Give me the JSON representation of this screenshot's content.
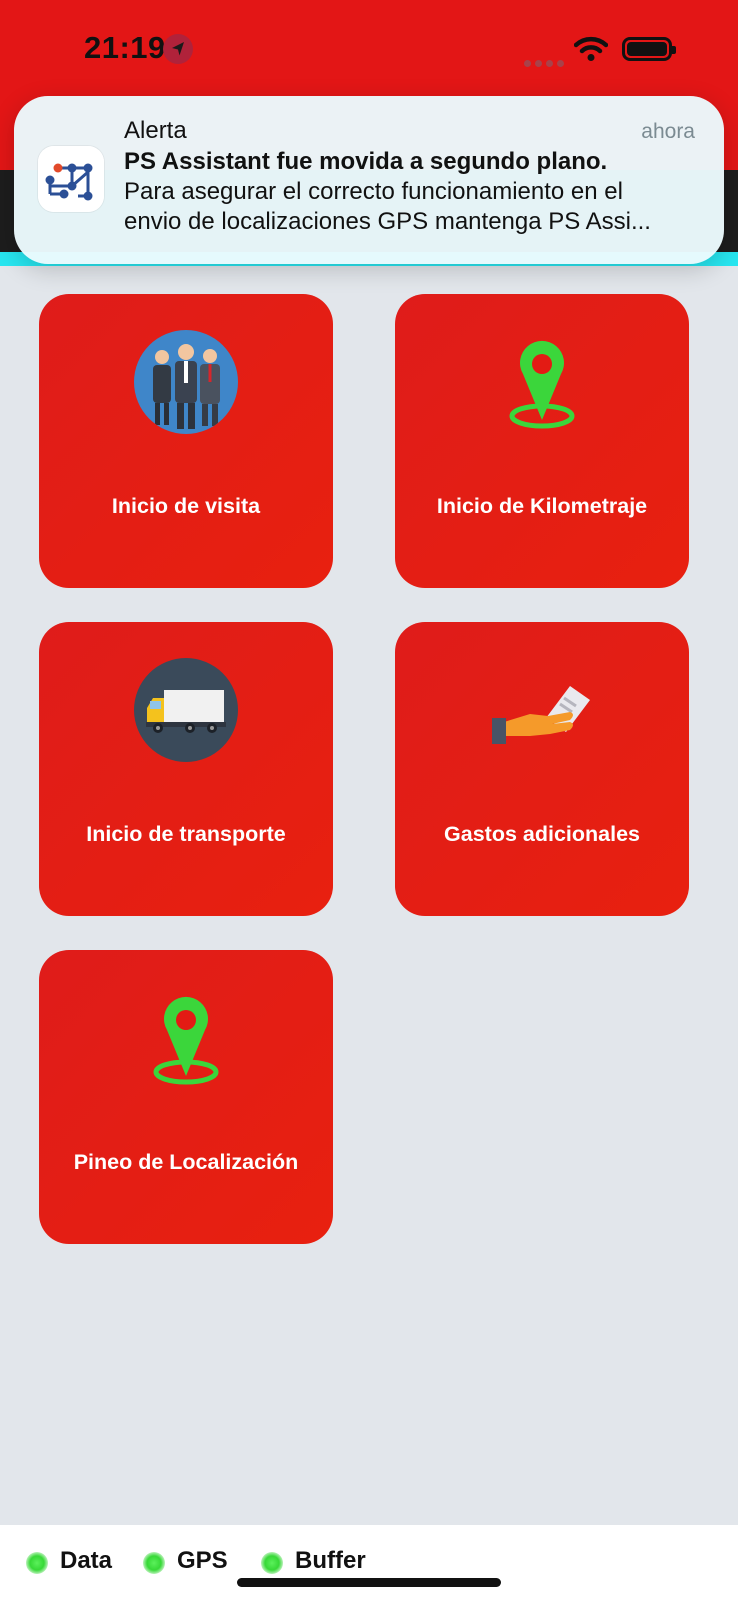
{
  "status_bar": {
    "time": "21:19",
    "background": "#e31616",
    "icons": [
      "location-arrow-icon",
      "signal-icon",
      "wifi-icon",
      "battery-icon"
    ]
  },
  "notification": {
    "title": "Alerta",
    "time": "ahora",
    "headline": "PS Assistant fue movida a segundo plano.",
    "body_line1": "Para asegurar el correcto funcionamiento en el",
    "body_line2": "envio de localizaciones GPS mantenga PS Assi...",
    "app_icon": "ps-assistant-app-icon"
  },
  "tiles": [
    {
      "label": "Inicio de visita",
      "icon": "business-people-icon"
    },
    {
      "label": "Inicio de Kilometraje",
      "icon": "map-pin-icon"
    },
    {
      "label": "Inicio de transporte",
      "icon": "truck-icon"
    },
    {
      "label": "Gastos adicionales",
      "icon": "hand-receipt-icon"
    },
    {
      "label": "Pineo de Localización",
      "icon": "map-pin-icon"
    }
  ],
  "indicators": [
    {
      "label": "Data",
      "status_color": "#37d937"
    },
    {
      "label": "GPS",
      "status_color": "#37d937"
    },
    {
      "label": "Buffer",
      "status_color": "#37d937"
    }
  ],
  "colors": {
    "tile": "#e31b14",
    "page_background": "#e2e6eb",
    "pin_green": "#3bd63b",
    "accent_cyan": "#27e6f0"
  }
}
